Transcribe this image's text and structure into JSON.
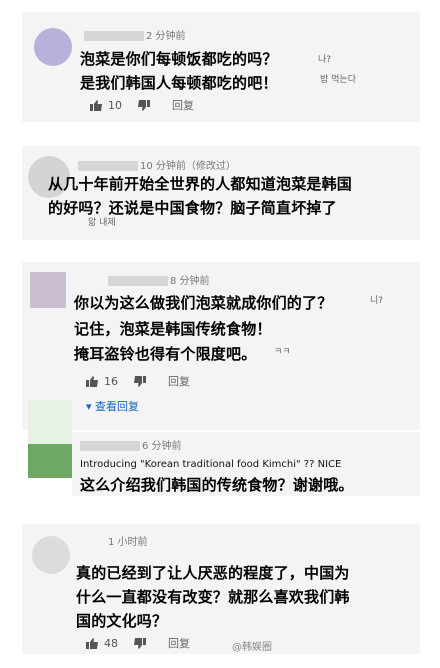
{
  "comments": [
    {
      "time": "2 分钟前",
      "lines": [
        "泡菜是你们每顿饭都吃的吗？",
        "是我们韩国人每顿都吃的吧！"
      ],
      "korean_trail_1": "나?",
      "korean_trail_2": "밥 먹는다",
      "likes": "10",
      "reply": "回复"
    },
    {
      "time": "10 分钟前（修改过）",
      "lines": [
        "从几十年前开始全世界的人都知道泡菜是韩国",
        "的好吗？还说是中国食物？脑子简直坏掉了"
      ],
      "korean_trail": "앎 내제",
      "likes": "",
      "reply": ""
    },
    {
      "time": "8 分钟前",
      "lines": [
        "你以为这么做我们泡菜就成你们的了？",
        "记住，泡菜是韩国传统食物！",
        "掩耳盗铃也得有个限度吧。"
      ],
      "korean_trail_1": "니?",
      "korean_trail_3": "ㅋㅋ",
      "likes": "16",
      "reply": "回复",
      "view_replies": "查看回复"
    },
    {
      "time": "6 分钟前",
      "english": "Introducing \"Korean traditional food Kimchi\" ?? NICE",
      "lines": [
        "这么介绍我们韩国的传统食物？谢谢哦。"
      ]
    },
    {
      "time": "1 小时前",
      "lines": [
        "真的已经到了让人厌恶的程度了，中国为",
        "什么一直都没有改变？就那么喜欢我们韩",
        "国的文化吗？"
      ],
      "likes": "48",
      "reply": "回复"
    }
  ],
  "watermark": "@韩娱圈",
  "icons": [
    "thumb-up-icon",
    "thumb-down-icon",
    "chevron-down-icon"
  ],
  "colors": {
    "link": "#1565c0",
    "card": "#f4f4f4"
  }
}
